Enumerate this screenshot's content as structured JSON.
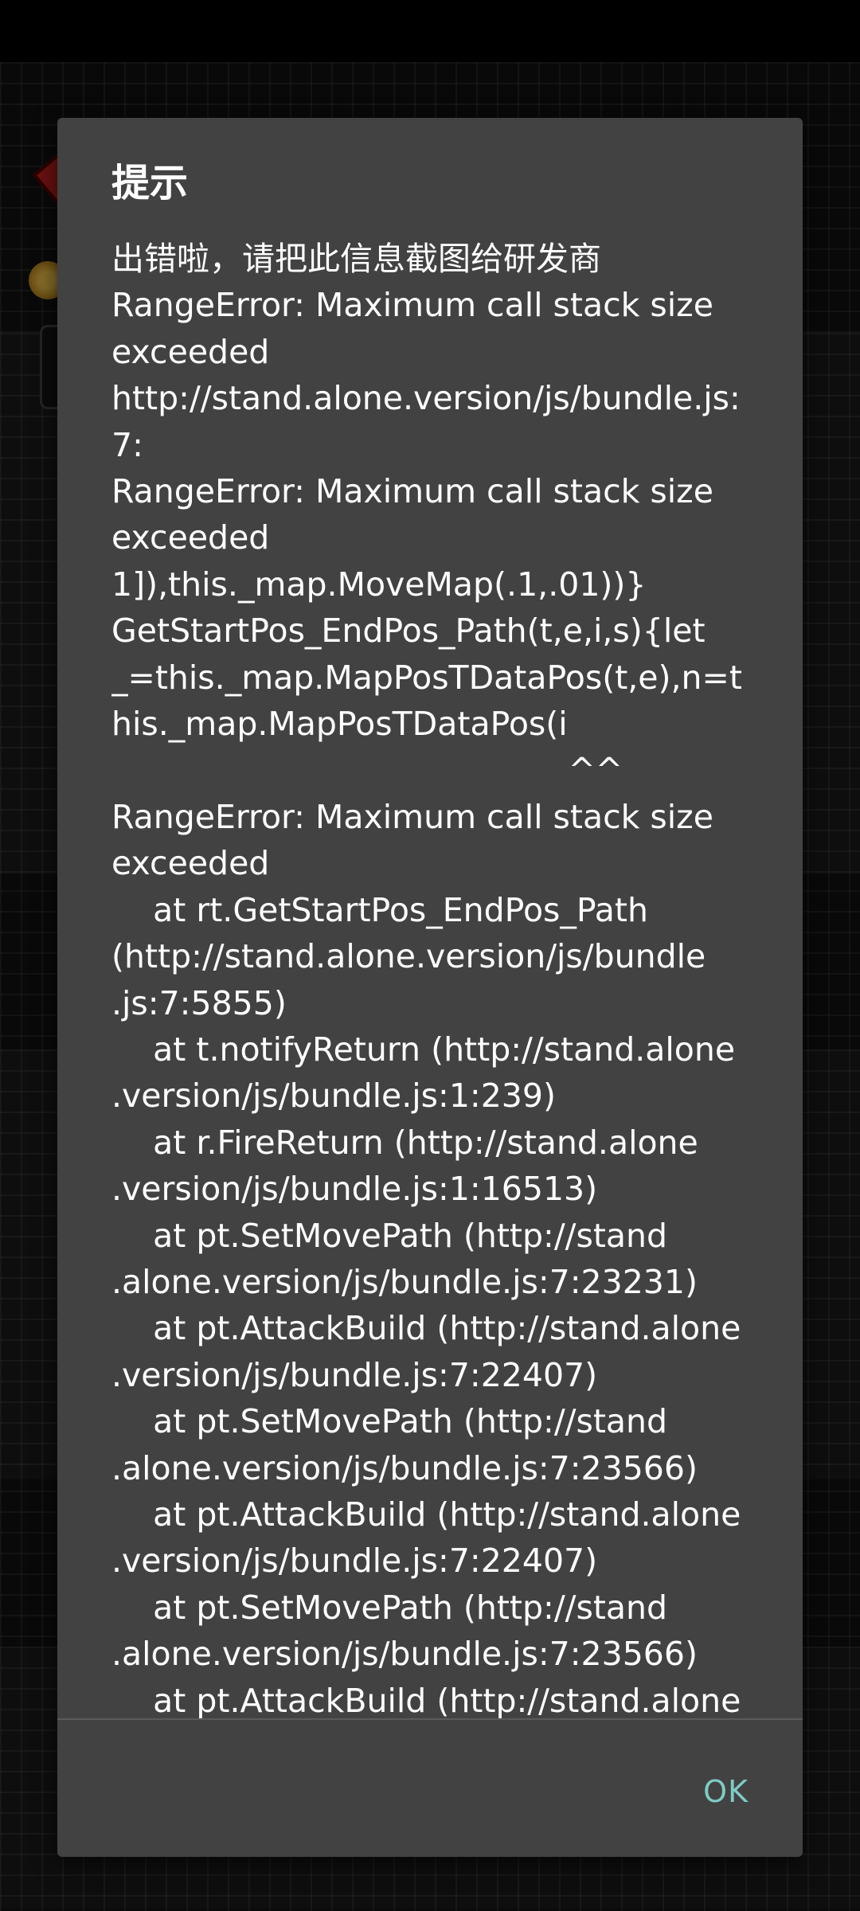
{
  "dialog": {
    "title": "提示",
    "message_lines": [
      "出错啦，请把此信息截图给研发商",
      "RangeError: Maximum call stack size",
      "exceeded",
      "http://stand.alone.version/js/bundle.js:",
      "7:",
      "RangeError: Maximum call stack size",
      "exceeded",
      "1]),this._map.MoveMap(.1,.01))}",
      "GetStartPos_EndPos_Path(t,e,i,s){let",
      "_=this._map.MapPosTDataPos(t,e),n=t",
      "his._map.MapPosTDataPos(i",
      "                                            ^^",
      "RangeError: Maximum call stack size",
      "exceeded",
      "    at rt.GetStartPos_EndPos_Path",
      "(http://stand.alone.version/js/bundle",
      ".js:7:5855)",
      "    at t.notifyReturn (http://stand.alone",
      ".version/js/bundle.js:1:239)",
      "    at r.FireReturn (http://stand.alone",
      ".version/js/bundle.js:1:16513)",
      "    at pt.SetMovePath (http://stand",
      ".alone.version/js/bundle.js:7:23231)",
      "    at pt.AttackBuild (http://stand.alone",
      ".version/js/bundle.js:7:22407)",
      "    at pt.SetMovePath (http://stand",
      ".alone.version/js/bundle.js:7:23566)",
      "    at pt.AttackBuild (http://stand.alone",
      ".version/js/bundle.js:7:22407)",
      "    at pt.SetMovePath (http://stand",
      ".alone.version/js/bundle.js:7:23566)",
      "    at pt.AttackBuild (http://stand.alone"
    ],
    "ok_label": "OK"
  },
  "colors": {
    "dialog_background": "#424242",
    "title_text": "#ffffff",
    "body_text": "#ffffff",
    "button_accent": "#7fcbc4",
    "divider": "#5a5a5a"
  }
}
